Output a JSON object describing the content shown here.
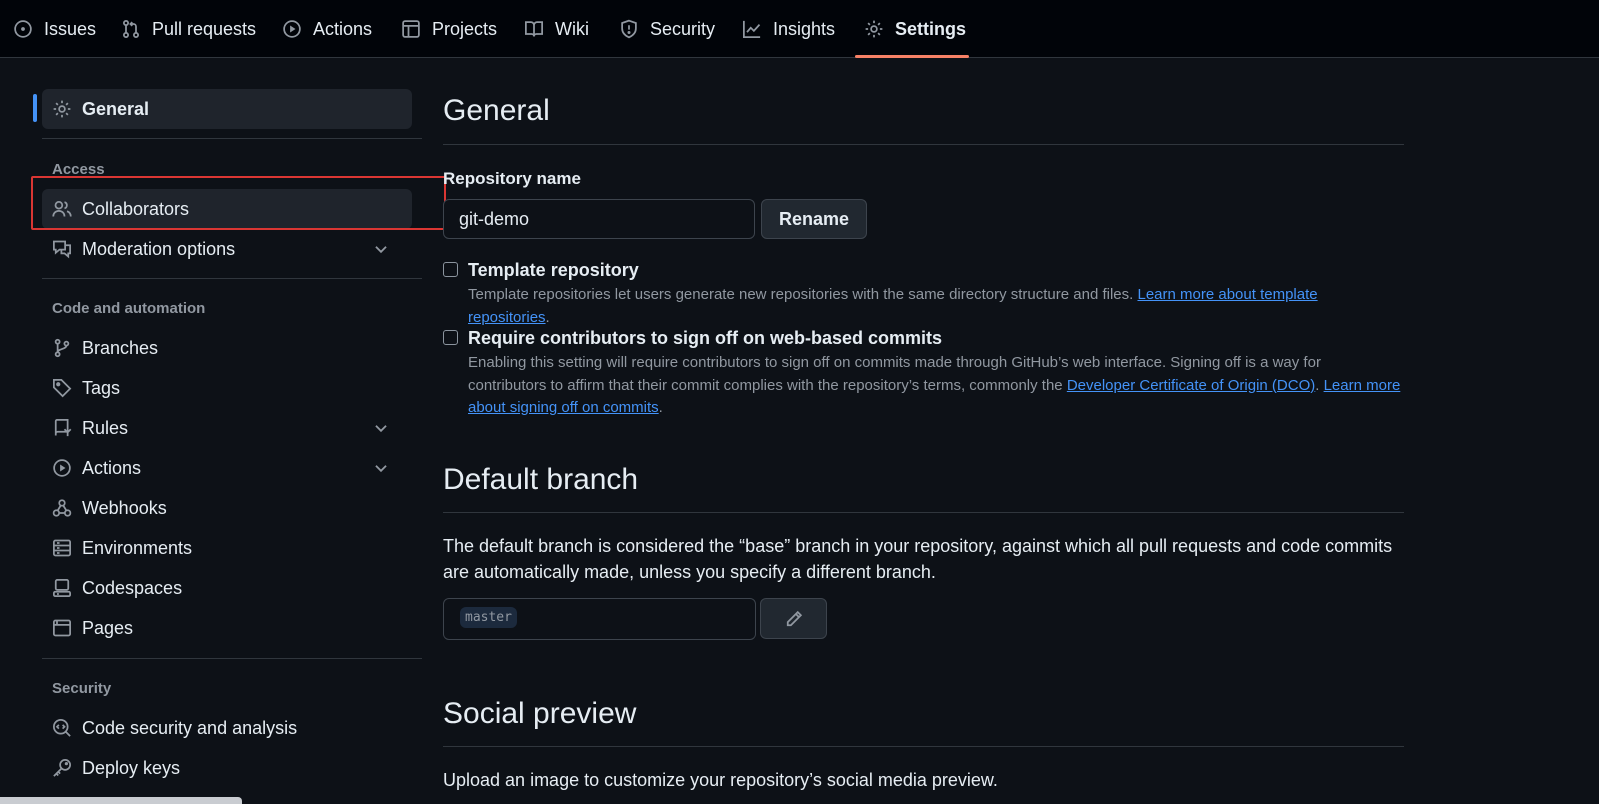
{
  "nav": {
    "tabs": [
      {
        "label": "Issues",
        "icon": "issue-opened-icon"
      },
      {
        "label": "Pull requests",
        "icon": "git-pull-request-icon"
      },
      {
        "label": "Actions",
        "icon": "play-icon"
      },
      {
        "label": "Projects",
        "icon": "table-icon"
      },
      {
        "label": "Wiki",
        "icon": "book-icon"
      },
      {
        "label": "Security",
        "icon": "shield-icon"
      },
      {
        "label": "Insights",
        "icon": "graph-icon"
      },
      {
        "label": "Settings",
        "icon": "gear-icon"
      }
    ],
    "active_tab": "Settings"
  },
  "sidebar": {
    "general": "General",
    "access_heading": "Access",
    "collaborators": "Collaborators",
    "moderation": "Moderation options",
    "code_heading": "Code and automation",
    "branches": "Branches",
    "tags": "Tags",
    "rules": "Rules",
    "actions": "Actions",
    "webhooks": "Webhooks",
    "environments": "Environments",
    "codespaces": "Codespaces",
    "pages": "Pages",
    "security_heading": "Security",
    "code_security": "Code security and analysis",
    "deploy_keys": "Deploy keys"
  },
  "main": {
    "title": "General",
    "repo_name_label": "Repository name",
    "repo_name_value": "git-demo",
    "rename_button": "Rename",
    "template_title": "Template repository",
    "template_desc": "Template repositories let users generate new repositories with the same directory structure and files.",
    "template_link": "Learn more about template repositories",
    "signoff_title": "Require contributors to sign off on web-based commits",
    "signoff_desc": "Enabling this setting will require contributors to sign off on commits made through GitHub’s web interface. Signing off is a way for contributors to affirm that their commit complies with the repository’s terms, commonly the",
    "signoff_link_dco": "Developer Certificate of Origin (DCO)",
    "signoff_link_learn": "Learn more about signing off on commits",
    "default_branch_title": "Default branch",
    "default_branch_desc": "The default branch is considered the “base” branch in your repository, against which all pull requests and code commits are automatically made, unless you specify a different branch.",
    "default_branch_value": "master",
    "social_title": "Social preview",
    "social_desc": "Upload an image to customize your repository’s social media preview."
  },
  "colors": {
    "background": "#0d1117",
    "accent": "#4493f8",
    "tab_underline": "#f78166",
    "highlight_box": "#da3633"
  }
}
